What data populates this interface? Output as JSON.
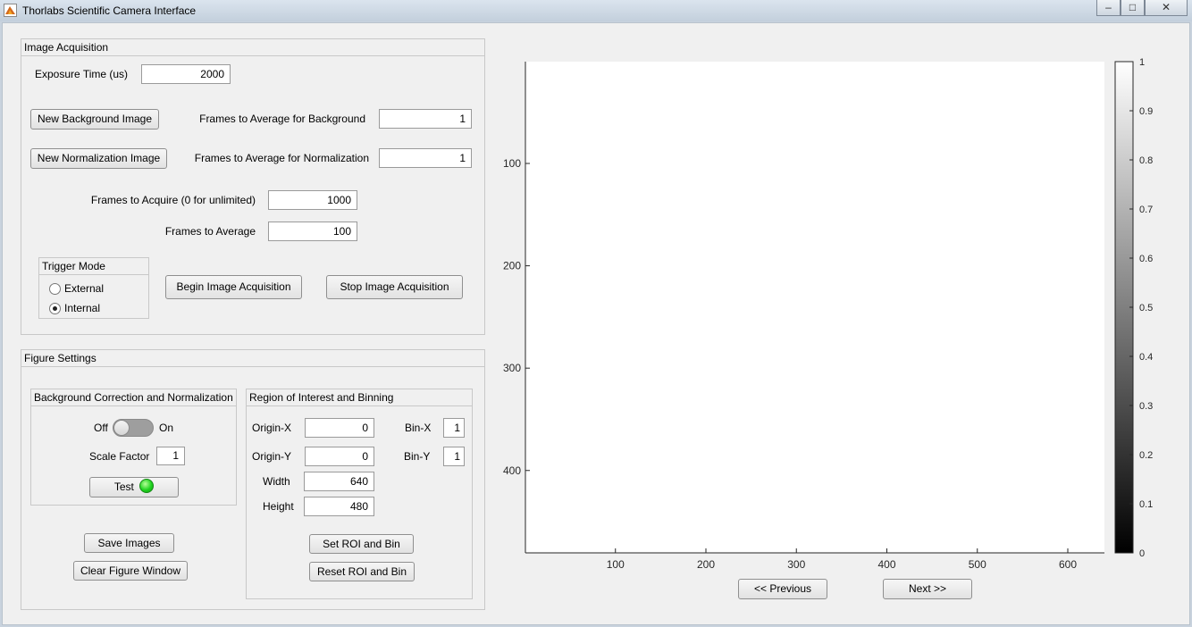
{
  "window": {
    "title": "Thorlabs Scientific Camera Interface",
    "min": "–",
    "max": "□",
    "close": "✕"
  },
  "acquisition": {
    "title": "Image Acquisition",
    "exposure_label": "Exposure Time (us)",
    "exposure_value": "2000",
    "new_bg_button": "New Background Image",
    "frames_bg_label": "Frames to Average for Background",
    "frames_bg_value": "1",
    "new_norm_button": "New Normalization Image",
    "frames_norm_label": "Frames to Average for Normalization",
    "frames_norm_value": "1",
    "frames_acquire_label": "Frames to Acquire (0 for unlimited)",
    "frames_acquire_value": "1000",
    "frames_average_label": "Frames to Average",
    "frames_average_value": "100",
    "trigger": {
      "title": "Trigger Mode",
      "external": "External",
      "internal": "Internal",
      "selected": "Internal"
    },
    "begin_button": "Begin Image Acquisition",
    "stop_button": "Stop Image Acquisition"
  },
  "figure": {
    "title": "Figure Settings",
    "bg": {
      "title": "Background Correction and Normalization",
      "off": "Off",
      "on": "On",
      "toggle_state": "off",
      "scale_label": "Scale Factor",
      "scale_value": "1",
      "test_button": "Test",
      "lamp_color": "#1fd31f"
    },
    "roi": {
      "title": "Region of Interest and Binning",
      "origin_x_label": "Origin-X",
      "origin_x": "0",
      "origin_y_label": "Origin-Y",
      "origin_y": "0",
      "width_label": "Width",
      "width": "640",
      "height_label": "Height",
      "height": "480",
      "bin_x_label": "Bin-X",
      "bin_x": "1",
      "bin_y_label": "Bin-Y",
      "bin_y": "1",
      "set_button": "Set ROI and Bin",
      "reset_button": "Reset ROI and Bin"
    },
    "save_button": "Save Images",
    "clear_button": "Clear Figure Window"
  },
  "plot": {
    "x_ticks": [
      "100",
      "200",
      "300",
      "400",
      "500",
      "600"
    ],
    "y_ticks": [
      "100",
      "200",
      "300",
      "400"
    ],
    "colorbar_ticks": [
      "0",
      "0.1",
      "0.2",
      "0.3",
      "0.4",
      "0.5",
      "0.6",
      "0.7",
      "0.8",
      "0.9",
      "1"
    ],
    "prev_button": "<< Previous",
    "next_button": "Next >>"
  }
}
